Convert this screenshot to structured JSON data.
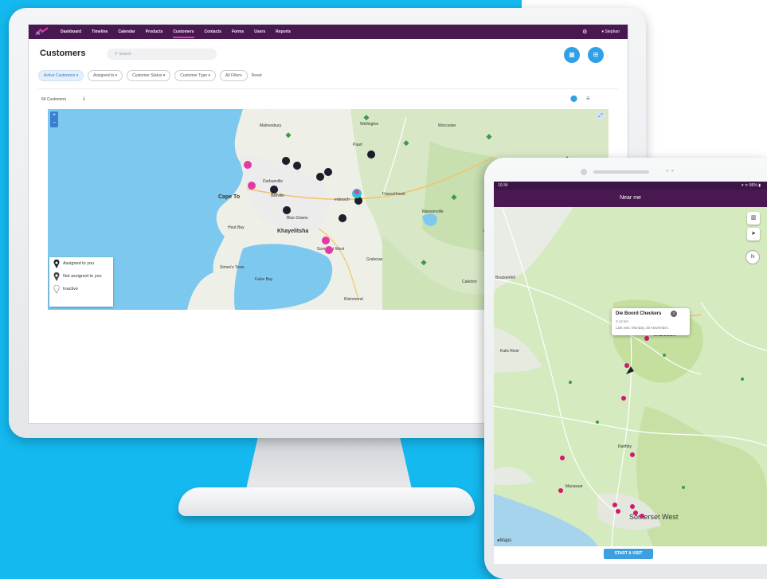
{
  "desktop": {
    "nav": {
      "items": [
        "Dashboard",
        "Timeline",
        "Calendar",
        "Products",
        "Customers",
        "Contacts",
        "Forms",
        "Users",
        "Reports"
      ],
      "active": "Customers",
      "user": "Stephan"
    },
    "page_title": "Customers",
    "search_placeholder": "Search",
    "filters": [
      "Active Customers",
      "Assigned to",
      "Customer Status",
      "Customer Type",
      "All Filters"
    ],
    "reset_label": "Reset",
    "customer_count": "64 Customers",
    "map_labels": {
      "cape_town": "Cape To",
      "khayelitsha": "Khayelitsha",
      "somerset_west": "Somerset West",
      "stellenbosch": "enbosch",
      "false_bay": "False Bay",
      "wellington": "Wellington",
      "worcester": "Worcester",
      "paarl": "Paarl",
      "franschhoek": "Franschhoek",
      "durbanville": "Durbanville",
      "bellville": "Bellville",
      "blue_downs": "Blue Downs",
      "malmesbury": "Malmesbury",
      "simons_town": "Simon's Town",
      "hout_bay": "Hout Bay",
      "rawsonville": "Rawsonville",
      "grabouw": "Grabouw",
      "caledon": "Caledon",
      "kleinmond": "Kleinmond"
    },
    "legend": {
      "assigned": "Assigned to you",
      "not_assigned": "Not assigned to you",
      "inactive": "Inactive"
    },
    "colors": {
      "nav": "#4a1850",
      "accent": "#e13aa6",
      "primary": "#2f9fe6"
    }
  },
  "tablet": {
    "status_time": "10:34",
    "status_icons": "▾ ᯤ 86% ▮",
    "title": "Near me",
    "popup": {
      "title": "Die Boord Checkers",
      "distance": "3.14 km",
      "last_visit": "Last visit: Monday, 20 November..."
    },
    "map_labels": {
      "brackenfell": "Brackenfell",
      "kuils_river": "Kuils River",
      "stellenbosch": "enbosch",
      "raithby": "Raithby",
      "macassar": "Macassar",
      "somerset_west": "Somerset West"
    },
    "maps_attribution": "Maps",
    "compass_label": "N",
    "button_label": "START A VISIT"
  }
}
